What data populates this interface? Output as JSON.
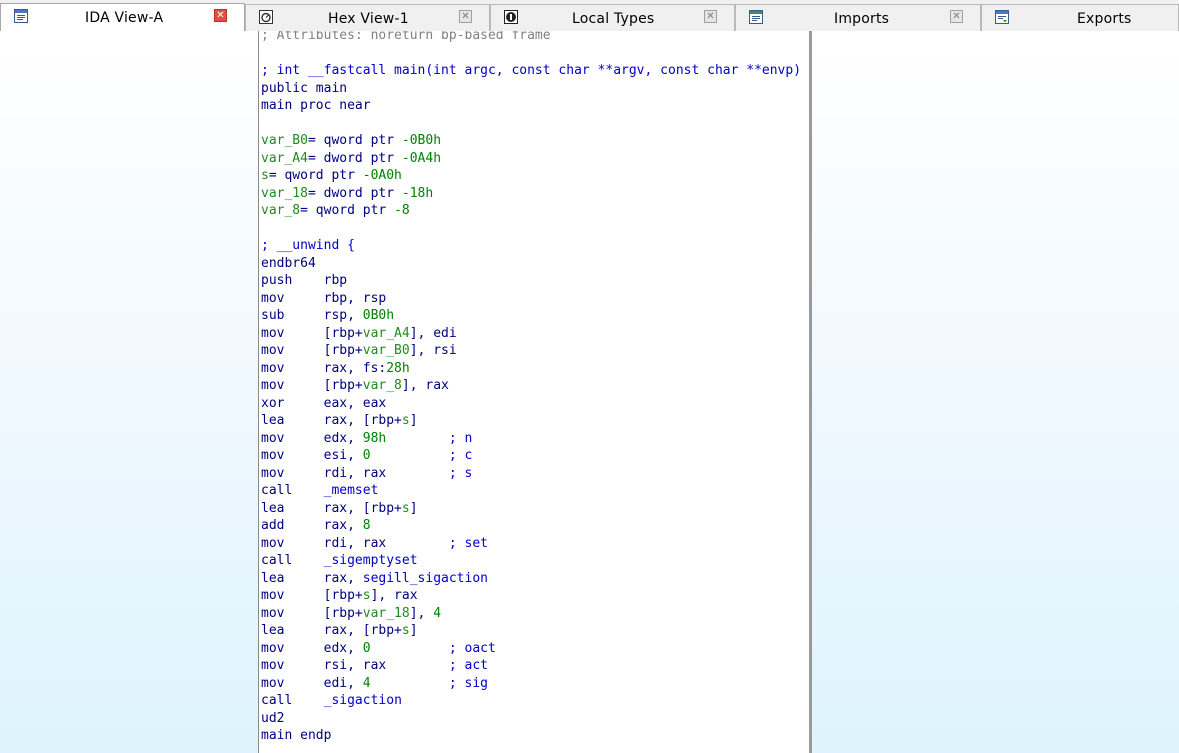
{
  "tabs": [
    {
      "label": "IDA View-A",
      "icon": "disassembly-view-icon",
      "active": true
    },
    {
      "label": "Hex View-1",
      "icon": "hex-view-icon",
      "active": false
    },
    {
      "label": "Local Types",
      "icon": "local-types-icon",
      "active": false
    },
    {
      "label": "Imports",
      "icon": "imports-icon",
      "active": false
    },
    {
      "label": "Exports",
      "icon": "exports-icon",
      "active": false
    }
  ],
  "colors": {
    "comment": "#808080",
    "keyword": "#0000c8",
    "instruction": "#000080",
    "number": "#008000",
    "variable": "#1e8c1e",
    "active_tab_close": "#e05040"
  },
  "disasm": {
    "lines": [
      {
        "parts": [
          {
            "t": "; Attributes: noreturn bp-based frame",
            "c": "c-comment"
          }
        ]
      },
      {
        "parts": [
          {
            "t": "",
            "c": ""
          }
        ]
      },
      {
        "parts": [
          {
            "t": "; int __fastcall main(int argc, const char **argv, const char **envp)",
            "c": "c-blue"
          }
        ]
      },
      {
        "parts": [
          {
            "t": "public main",
            "c": "c-navy"
          }
        ]
      },
      {
        "parts": [
          {
            "t": "main proc near",
            "c": "c-navy"
          }
        ]
      },
      {
        "parts": [
          {
            "t": "",
            "c": ""
          }
        ]
      },
      {
        "parts": [
          {
            "t": "var_B0",
            "c": "c-var"
          },
          {
            "t": "= qword ptr ",
            "c": "c-navy"
          },
          {
            "t": "-0B0h",
            "c": "c-green"
          }
        ]
      },
      {
        "parts": [
          {
            "t": "var_A4",
            "c": "c-var"
          },
          {
            "t": "= dword ptr ",
            "c": "c-navy"
          },
          {
            "t": "-0A4h",
            "c": "c-green"
          }
        ]
      },
      {
        "parts": [
          {
            "t": "s",
            "c": "c-var"
          },
          {
            "t": "= qword ptr ",
            "c": "c-navy"
          },
          {
            "t": "-0A0h",
            "c": "c-green"
          }
        ]
      },
      {
        "parts": [
          {
            "t": "var_18",
            "c": "c-var"
          },
          {
            "t": "= dword ptr ",
            "c": "c-navy"
          },
          {
            "t": "-18h",
            "c": "c-green"
          }
        ]
      },
      {
        "parts": [
          {
            "t": "var_8",
            "c": "c-var"
          },
          {
            "t": "= qword ptr ",
            "c": "c-navy"
          },
          {
            "t": "-8",
            "c": "c-green"
          }
        ]
      },
      {
        "parts": [
          {
            "t": "",
            "c": ""
          }
        ]
      },
      {
        "parts": [
          {
            "t": "; __unwind {",
            "c": "c-blue"
          }
        ]
      },
      {
        "parts": [
          {
            "t": "endbr64",
            "c": "c-navy"
          }
        ]
      },
      {
        "parts": [
          {
            "t": "push    rbp",
            "c": "c-navy"
          }
        ]
      },
      {
        "parts": [
          {
            "t": "mov     rbp, rsp",
            "c": "c-navy"
          }
        ]
      },
      {
        "parts": [
          {
            "t": "sub     rsp, ",
            "c": "c-navy"
          },
          {
            "t": "0B0h",
            "c": "c-green"
          }
        ]
      },
      {
        "parts": [
          {
            "t": "mov     [rbp+",
            "c": "c-navy"
          },
          {
            "t": "var_A4",
            "c": "c-var"
          },
          {
            "t": "], edi",
            "c": "c-navy"
          }
        ]
      },
      {
        "parts": [
          {
            "t": "mov     [rbp+",
            "c": "c-navy"
          },
          {
            "t": "var_B0",
            "c": "c-var"
          },
          {
            "t": "], rsi",
            "c": "c-navy"
          }
        ]
      },
      {
        "parts": [
          {
            "t": "mov     rax, fs:",
            "c": "c-navy"
          },
          {
            "t": "28h",
            "c": "c-green"
          }
        ]
      },
      {
        "parts": [
          {
            "t": "mov     [rbp+",
            "c": "c-navy"
          },
          {
            "t": "var_8",
            "c": "c-var"
          },
          {
            "t": "], rax",
            "c": "c-navy"
          }
        ]
      },
      {
        "parts": [
          {
            "t": "xor     eax, eax",
            "c": "c-navy"
          }
        ]
      },
      {
        "parts": [
          {
            "t": "lea     rax, [rbp+",
            "c": "c-navy"
          },
          {
            "t": "s",
            "c": "c-var"
          },
          {
            "t": "]",
            "c": "c-navy"
          }
        ]
      },
      {
        "parts": [
          {
            "t": "mov     edx, ",
            "c": "c-navy"
          },
          {
            "t": "98h",
            "c": "c-green"
          },
          {
            "t": "        ; n",
            "c": "c-blue"
          }
        ]
      },
      {
        "parts": [
          {
            "t": "mov     esi, ",
            "c": "c-navy"
          },
          {
            "t": "0",
            "c": "c-green"
          },
          {
            "t": "          ; c",
            "c": "c-blue"
          }
        ]
      },
      {
        "parts": [
          {
            "t": "mov     rdi, rax        ",
            "c": "c-navy"
          },
          {
            "t": "; s",
            "c": "c-blue"
          }
        ]
      },
      {
        "parts": [
          {
            "t": "call    ",
            "c": "c-navy"
          },
          {
            "t": "_memset",
            "c": "c-blue"
          }
        ]
      },
      {
        "parts": [
          {
            "t": "lea     rax, [rbp+",
            "c": "c-navy"
          },
          {
            "t": "s",
            "c": "c-var"
          },
          {
            "t": "]",
            "c": "c-navy"
          }
        ]
      },
      {
        "parts": [
          {
            "t": "add     rax, ",
            "c": "c-navy"
          },
          {
            "t": "8",
            "c": "c-green"
          }
        ]
      },
      {
        "parts": [
          {
            "t": "mov     rdi, rax        ",
            "c": "c-navy"
          },
          {
            "t": "; set",
            "c": "c-blue"
          }
        ]
      },
      {
        "parts": [
          {
            "t": "call    ",
            "c": "c-navy"
          },
          {
            "t": "_sigemptyset",
            "c": "c-blue"
          }
        ]
      },
      {
        "parts": [
          {
            "t": "lea     rax, ",
            "c": "c-navy"
          },
          {
            "t": "segill_sigaction",
            "c": "c-blue"
          }
        ]
      },
      {
        "parts": [
          {
            "t": "mov     [rbp+",
            "c": "c-navy"
          },
          {
            "t": "s",
            "c": "c-var"
          },
          {
            "t": "], rax",
            "c": "c-navy"
          }
        ]
      },
      {
        "parts": [
          {
            "t": "mov     [rbp+",
            "c": "c-navy"
          },
          {
            "t": "var_18",
            "c": "c-var"
          },
          {
            "t": "], ",
            "c": "c-navy"
          },
          {
            "t": "4",
            "c": "c-green"
          }
        ]
      },
      {
        "parts": [
          {
            "t": "lea     rax, [rbp+",
            "c": "c-navy"
          },
          {
            "t": "s",
            "c": "c-var"
          },
          {
            "t": "]",
            "c": "c-navy"
          }
        ]
      },
      {
        "parts": [
          {
            "t": "mov     edx, ",
            "c": "c-navy"
          },
          {
            "t": "0",
            "c": "c-green"
          },
          {
            "t": "          ; oact",
            "c": "c-blue"
          }
        ]
      },
      {
        "parts": [
          {
            "t": "mov     rsi, rax        ",
            "c": "c-navy"
          },
          {
            "t": "; act",
            "c": "c-blue"
          }
        ]
      },
      {
        "parts": [
          {
            "t": "mov     edi, ",
            "c": "c-navy"
          },
          {
            "t": "4",
            "c": "c-green"
          },
          {
            "t": "          ; sig",
            "c": "c-blue"
          }
        ]
      },
      {
        "parts": [
          {
            "t": "call    ",
            "c": "c-navy"
          },
          {
            "t": "_sigaction",
            "c": "c-blue"
          }
        ]
      },
      {
        "parts": [
          {
            "t": "ud2",
            "c": "c-navy"
          }
        ]
      },
      {
        "parts": [
          {
            "t": "main endp",
            "c": "c-navy"
          }
        ]
      }
    ]
  }
}
